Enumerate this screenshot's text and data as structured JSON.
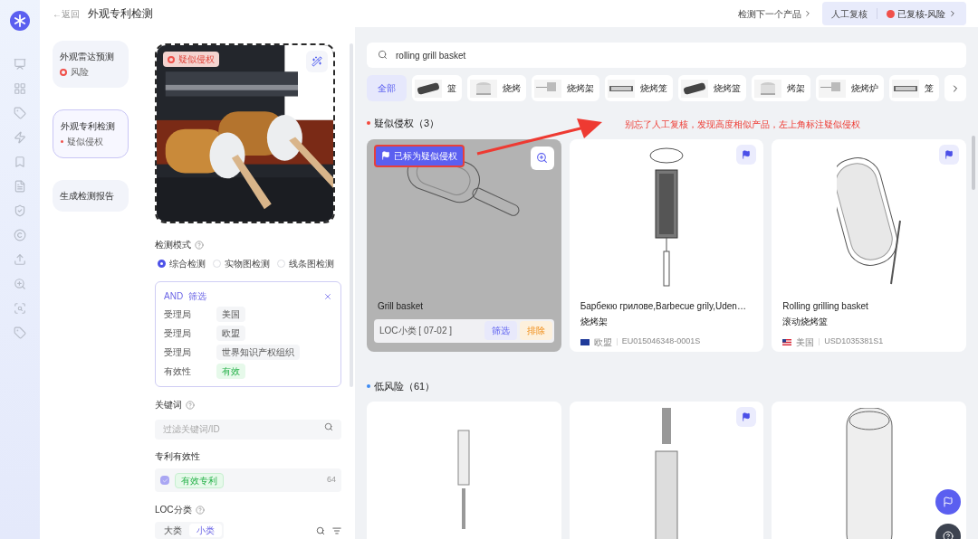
{
  "header": {
    "back": "←返回",
    "title": "外观专利检测",
    "next_product": "检测下一个产品",
    "review": "人工复核",
    "review_status": "已复核-风险"
  },
  "nav": [
    {
      "title": "外观雷达预测",
      "status": "风险",
      "kind": "risk",
      "selected": false
    },
    {
      "title": "外观专利检测",
      "status": "疑似侵权",
      "kind": "suspect",
      "selected": true
    },
    {
      "title": "生成检测报告",
      "kind": "plain",
      "selected": false
    }
  ],
  "product_image": {
    "badge": "疑似侵权"
  },
  "mode": {
    "label": "检测模式",
    "options": [
      {
        "label": "综合检测",
        "selected": true
      },
      {
        "label": "实物图检测",
        "selected": false
      },
      {
        "label": "线条图检测",
        "selected": false
      }
    ]
  },
  "filter": {
    "logic": "AND",
    "title": "筛选",
    "rows": [
      {
        "label": "受理局",
        "value": "美国",
        "kind": "plain"
      },
      {
        "label": "受理局",
        "value": "欧盟",
        "kind": "plain"
      },
      {
        "label": "受理局",
        "value": "世界知识产权组织",
        "kind": "plain"
      },
      {
        "label": "有效性",
        "value": "有效",
        "kind": "valid"
      }
    ]
  },
  "keyword": {
    "label": "关键词",
    "placeholder": "过滤关键词/ID"
  },
  "validity": {
    "label": "专利有效性",
    "items": [
      {
        "tag": "有效专利",
        "count": "64",
        "checked": true
      }
    ]
  },
  "loc": {
    "label": "LOC分类",
    "tabs": [
      {
        "label": "大类",
        "selected": false
      },
      {
        "label": "小类",
        "selected": true
      }
    ]
  },
  "search": {
    "value": "rolling grill basket"
  },
  "categories": [
    {
      "label": "全部",
      "selected": true
    },
    {
      "label": "篮",
      "selected": false
    },
    {
      "label": "烧烤",
      "selected": false
    },
    {
      "label": "烧烤架",
      "selected": false
    },
    {
      "label": "烧烤笼",
      "selected": false
    },
    {
      "label": "烧烤篮",
      "selected": false
    },
    {
      "label": "烤架",
      "selected": false
    },
    {
      "label": "烧烤炉",
      "selected": false
    },
    {
      "label": "笼",
      "selected": false
    }
  ],
  "annotation": {
    "text": "别忘了人工复核，发现高度相似产品，左上角标注疑似侵权"
  },
  "sections": [
    {
      "title": "疑似侵权（3）",
      "color": "#f5483b",
      "cards": [
        {
          "title": "Grill basket",
          "marked_label": "已标为疑似侵权",
          "loc": "LOC小类 [ 07-02 ]",
          "actions": [
            "筛选",
            "排除"
          ],
          "flag_button": false
        },
        {
          "title": "Барбекю грилове,Barbecue grily,Uden…",
          "subtitle": "烧烤架",
          "office": "欧盟",
          "number": "EU015046348-0001S",
          "flag_button": true
        },
        {
          "title": "Rolling grilling basket",
          "subtitle": "滚动烧烤篮",
          "office": "美国",
          "number": "USD1035381S1",
          "flag_button": true
        }
      ]
    },
    {
      "title": "低风险（61）",
      "color": "#3d8bf2",
      "cards": [
        {
          "flag_button": false
        },
        {
          "flag_button": true
        },
        {
          "flag_button": false
        }
      ]
    }
  ]
}
